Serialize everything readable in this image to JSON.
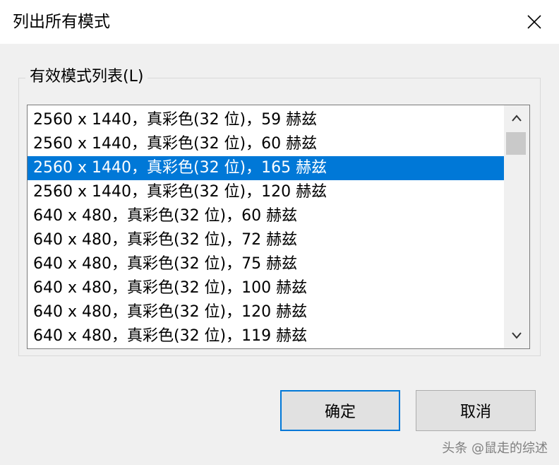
{
  "window": {
    "title": "列出所有模式"
  },
  "group": {
    "label": "有效模式列表(L)"
  },
  "modes": [
    "2560 x 1440，真彩色(32 位)，59 赫兹",
    "2560 x 1440，真彩色(32 位)，60 赫兹",
    "2560 x 1440，真彩色(32 位)，165 赫兹",
    "2560 x 1440，真彩色(32 位)，120 赫兹",
    "640 x 480，真彩色(32 位)，60 赫兹",
    "640 x 480，真彩色(32 位)，72 赫兹",
    "640 x 480，真彩色(32 位)，75 赫兹",
    "640 x 480，真彩色(32 位)，100 赫兹",
    "640 x 480，真彩色(32 位)，120 赫兹",
    "640 x 480，真彩色(32 位)，119 赫兹"
  ],
  "selected_index": 2,
  "buttons": {
    "ok": "确定",
    "cancel": "取消"
  },
  "watermark": "头条 @鼠走的综述",
  "colors": {
    "selection": "#0078d7",
    "focus_border": "#0078d7"
  },
  "icons": {
    "close": "close-icon",
    "scroll_up": "chevron-up-icon",
    "scroll_down": "chevron-down-icon"
  }
}
